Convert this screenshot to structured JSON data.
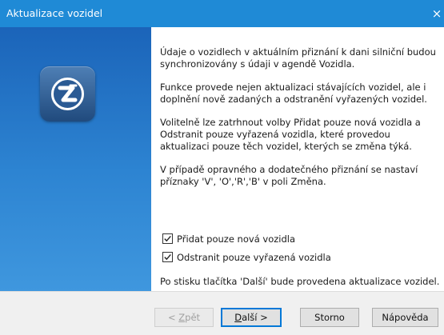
{
  "window": {
    "title": "Aktualizace vozidel",
    "close_glyph": "×"
  },
  "content": {
    "paragraphs": [
      "Údaje o vozidlech v aktuálním přiznání k dani silniční budou synchronizovány s údaji v agendě Vozidla.",
      "Funkce provede nejen aktualizaci stávajících vozidel, ale i doplnění nově zadaných a odstranění vyřazených vozidel.",
      "Volitelně lze zatrhnout volby Přidat pouze nová vozidla a Odstranit pouze vyřazená vozidla, které provedou aktualizaci pouze těch vozidel, kterých se změna týká.",
      "V případě opravného a dodatečného přiznání se nastaví příznaky 'V', 'O','R','B' v poli Změna."
    ],
    "options": [
      {
        "label": "Přidat pouze nová vozidla",
        "checked": true
      },
      {
        "label": "Odstranit pouze vyřazená vozidla",
        "checked": true
      }
    ],
    "footnote": "Po stisku tlačítka 'Další' bude provedena aktualizace vozidel."
  },
  "buttons": {
    "back": {
      "prefix": "< ",
      "mnemonic": "Z",
      "rest": "pět",
      "enabled": false
    },
    "next": {
      "mnemonic": "D",
      "rest": "alší >",
      "enabled": true
    },
    "cancel": "Storno",
    "help": "Nápověda"
  },
  "icons": {
    "logo": "app-logo-icon",
    "checkbox": "checkmark-icon"
  },
  "colors": {
    "titlebar": "#1f8ad6",
    "sidepanel": "#2d84d2",
    "default_button_border": "#0078d7"
  }
}
